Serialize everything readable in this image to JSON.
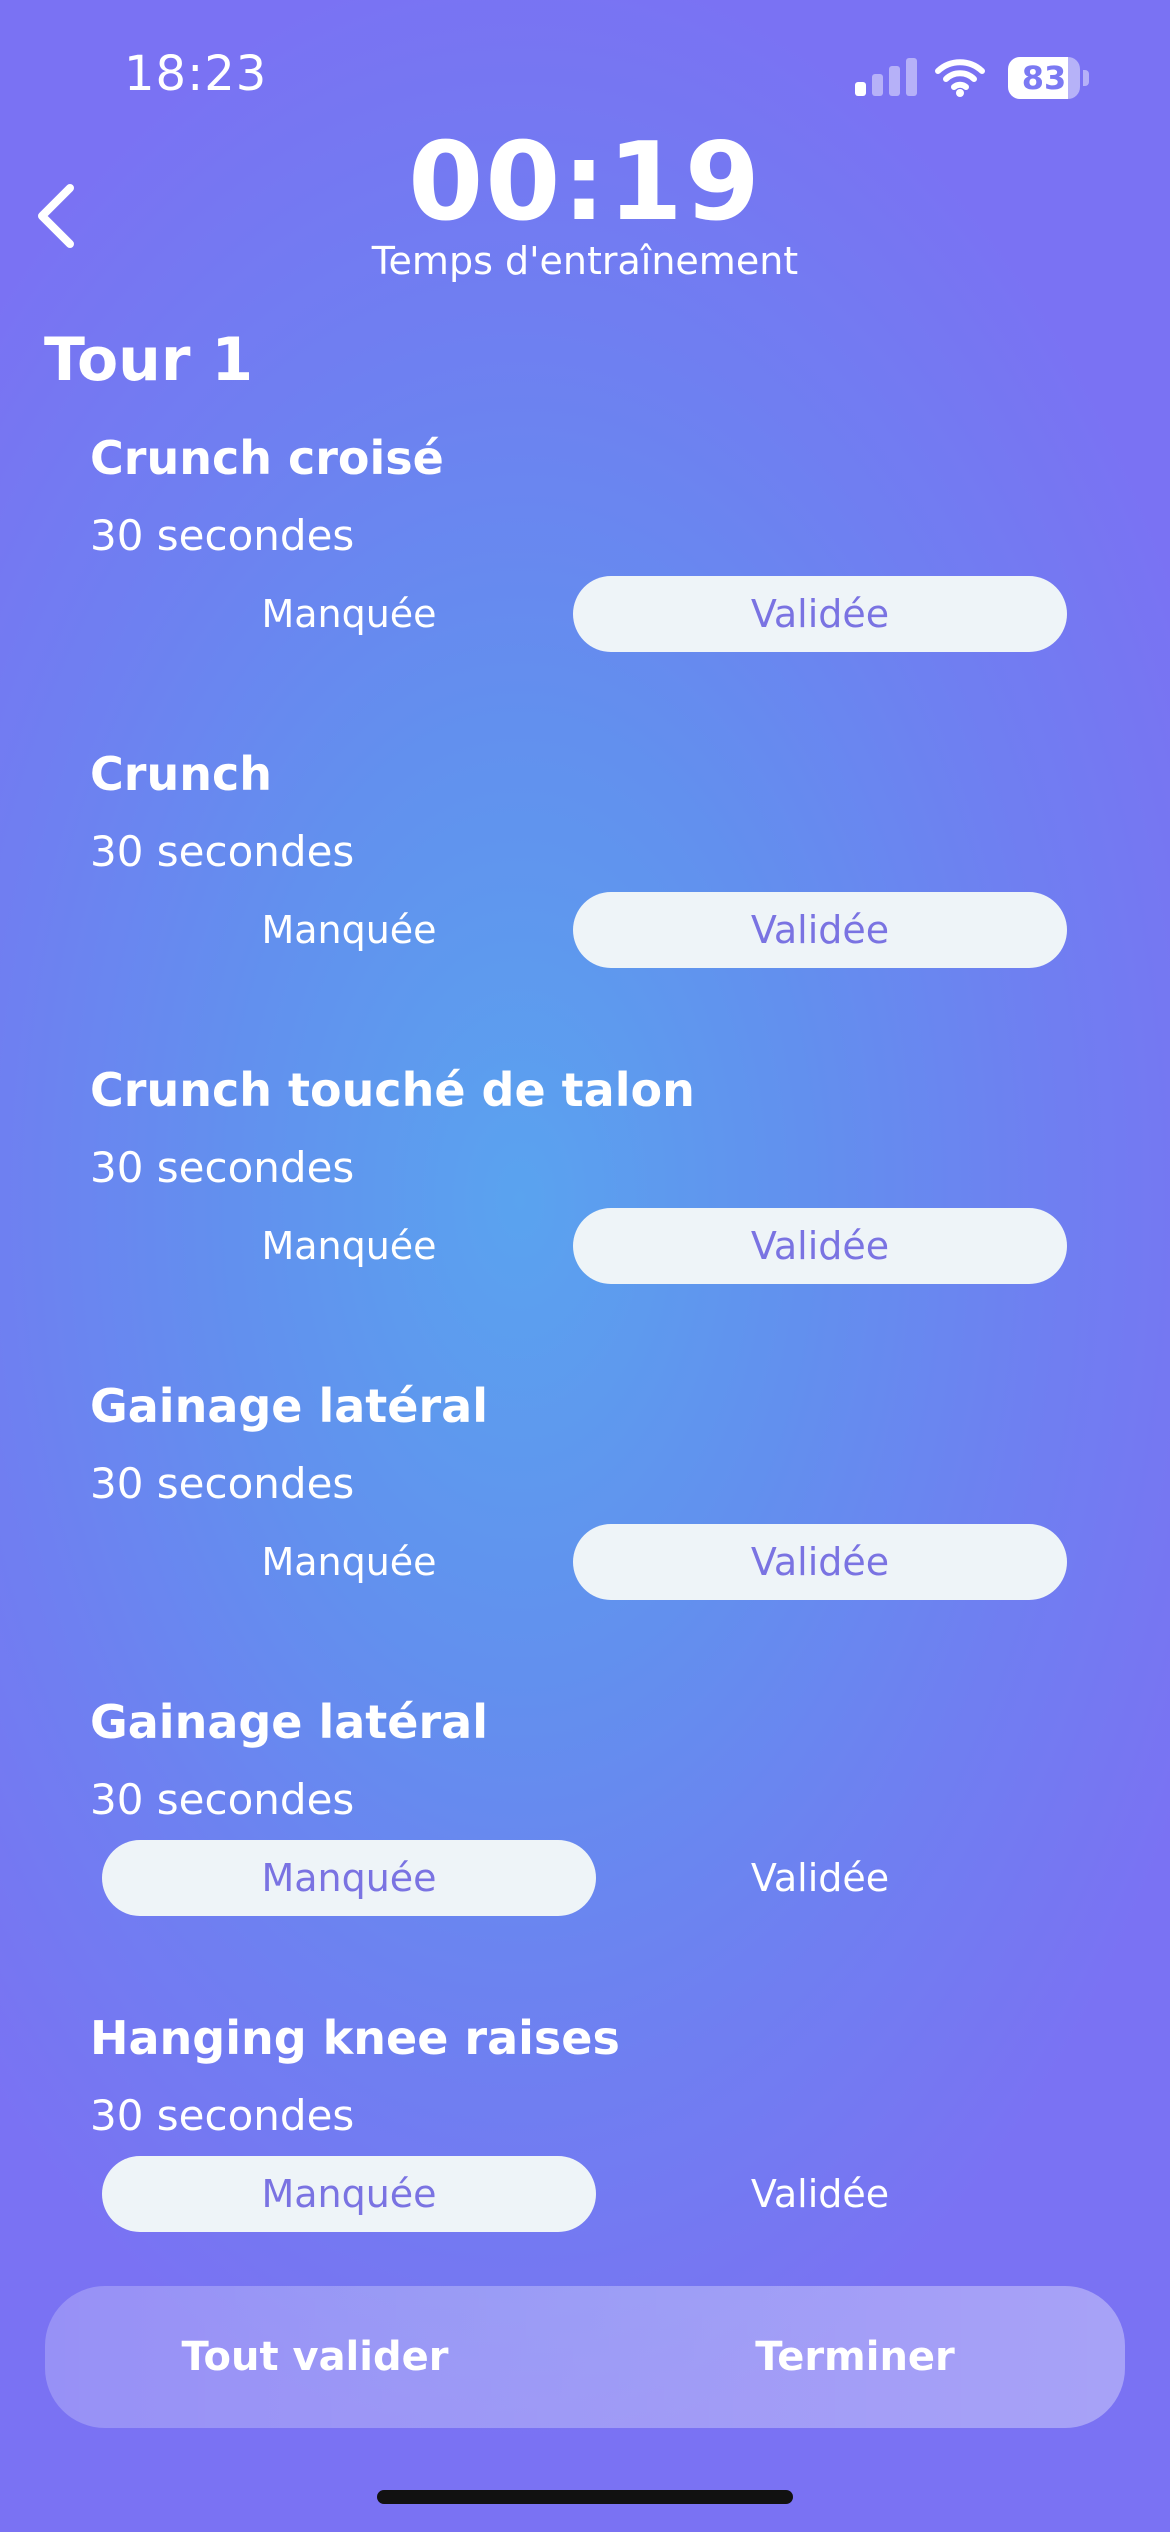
{
  "status_bar": {
    "time": "18:23",
    "battery": "83"
  },
  "header": {
    "timer": "00:19",
    "timer_label": "Temps d'entraînement"
  },
  "round": {
    "title": "Tour 1"
  },
  "exercises": [
    {
      "name": "Crunch croisé",
      "duration": "30 secondes",
      "missed_label": "Manquée",
      "validated_label": "Validée",
      "status": "validated"
    },
    {
      "name": "Crunch",
      "duration": "30 secondes",
      "missed_label": "Manquée",
      "validated_label": "Validée",
      "status": "validated"
    },
    {
      "name": "Crunch touché de talon",
      "duration": "30 secondes",
      "missed_label": "Manquée",
      "validated_label": "Validée",
      "status": "validated"
    },
    {
      "name": "Gainage latéral",
      "duration": "30 secondes",
      "missed_label": "Manquée",
      "validated_label": "Validée",
      "status": "validated"
    },
    {
      "name": "Gainage latéral",
      "duration": "30 secondes",
      "missed_label": "Manquée",
      "validated_label": "Validée",
      "status": "missed"
    },
    {
      "name": "Hanging knee raises",
      "duration": "30 secondes",
      "missed_label": "Manquée",
      "validated_label": "Validée",
      "status": "missed"
    }
  ],
  "actions": {
    "validate_all": "Tout valider",
    "finish": "Terminer"
  },
  "colors": {
    "background_top": "#7a72f3",
    "background_center": "#5aa3ef",
    "selected_pill": "#eef4f8",
    "selected_text": "#7a73e2"
  },
  "icons": {
    "back": "chevron-left-icon",
    "signal": "cellular-signal-icon",
    "wifi": "wifi-icon",
    "battery": "battery-icon"
  }
}
